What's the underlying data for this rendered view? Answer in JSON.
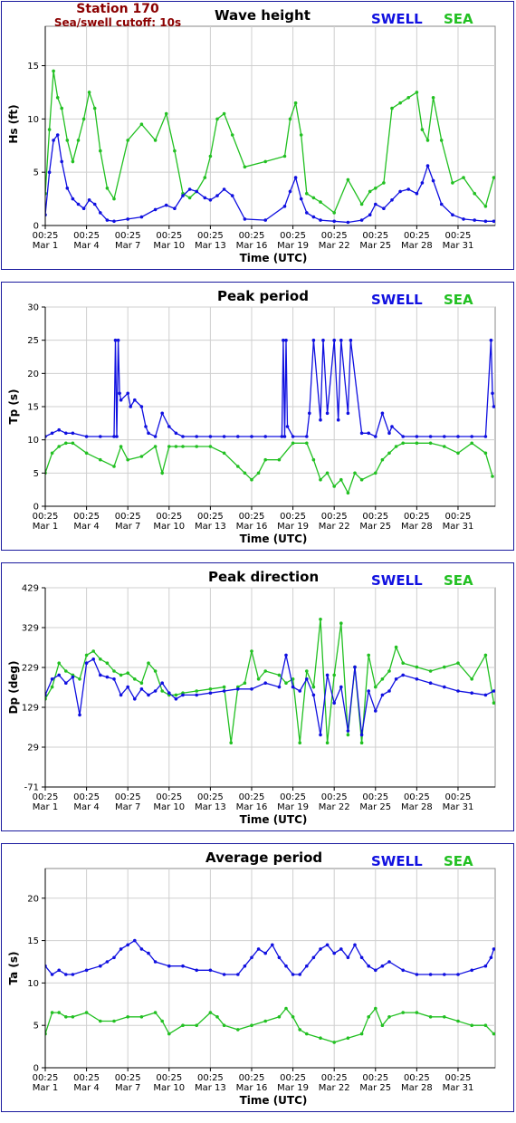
{
  "header": {
    "station": "Station 170",
    "cutoff": "Sea/swell cutoff: 10s"
  },
  "legend": {
    "swell": "SWELL",
    "sea": "SEA"
  },
  "colors": {
    "swell": "#1010e0",
    "sea": "#22c022",
    "frame": "#1a1a9e",
    "header": "#8b0000"
  },
  "x_ticks": {
    "times": [
      "00:25",
      "00:25",
      "00:25",
      "00:25",
      "00:25",
      "00:25",
      "00:25",
      "00:25",
      "00:25",
      "00:25",
      "00:25"
    ],
    "dates": [
      "Mar 1",
      "Mar 4",
      "Mar 7",
      "Mar 10",
      "Mar 13",
      "Mar 16",
      "Mar 19",
      "Mar 22",
      "Mar 25",
      "Mar 28",
      "Mar 31"
    ],
    "days": [
      1,
      4,
      7,
      10,
      13,
      16,
      19,
      22,
      25,
      28,
      31
    ]
  },
  "chart_data": [
    {
      "type": "line",
      "title": "Wave height",
      "ylabel": "Hs (ft)",
      "xlabel": "Time (UTC)",
      "xlim": [
        1,
        33.7
      ],
      "ylim": [
        0,
        18.7
      ],
      "yticks": [
        0,
        5,
        10,
        15
      ],
      "grid": true,
      "legend": "top-right",
      "series": [
        {
          "name": "SWELL",
          "color": "#1010e0",
          "x": [
            1,
            1.3,
            1.6,
            1.9,
            2.2,
            2.6,
            3,
            3.4,
            3.8,
            4.2,
            4.6,
            5,
            5.5,
            6,
            7,
            8,
            9,
            9.8,
            10.4,
            11,
            11.5,
            12,
            12.6,
            13,
            13.5,
            14,
            14.6,
            15.5,
            17,
            18.4,
            18.8,
            19.2,
            19.6,
            20,
            20.5,
            21,
            22,
            23,
            24,
            24.6,
            25,
            25.6,
            26.2,
            26.8,
            27.4,
            28,
            28.4,
            28.8,
            29.2,
            29.8,
            30.6,
            31.4,
            32.2,
            33,
            33.6
          ],
          "y": [
            1,
            5,
            8,
            8.5,
            6,
            3.5,
            2.5,
            2,
            1.6,
            2.4,
            2,
            1.2,
            0.5,
            0.4,
            0.6,
            0.8,
            1.5,
            1.9,
            1.6,
            2.8,
            3.4,
            3.2,
            2.6,
            2.4,
            2.8,
            3.4,
            2.8,
            0.6,
            0.5,
            1.8,
            3.2,
            4.5,
            2.5,
            1.2,
            0.8,
            0.5,
            0.4,
            0.3,
            0.5,
            1,
            2,
            1.6,
            2.4,
            3.2,
            3.4,
            3,
            4,
            5.6,
            4.2,
            2,
            1,
            0.6,
            0.5,
            0.4,
            0.4
          ]
        },
        {
          "name": "SEA",
          "color": "#22c022",
          "x": [
            1,
            1.3,
            1.6,
            1.9,
            2.2,
            2.6,
            3,
            3.4,
            3.8,
            4.2,
            4.6,
            5,
            5.5,
            6,
            7,
            8,
            9,
            9.8,
            10.4,
            11,
            11.5,
            12,
            12.6,
            13,
            13.5,
            14,
            14.6,
            15.5,
            17,
            18.4,
            18.8,
            19.2,
            19.6,
            20,
            20.5,
            21,
            22,
            23,
            24,
            24.6,
            25,
            25.6,
            26.2,
            26.8,
            27.4,
            28,
            28.4,
            28.8,
            29.2,
            29.8,
            30.6,
            31.4,
            32.2,
            33,
            33.6
          ],
          "y": [
            3,
            9,
            14.5,
            12,
            11,
            8,
            6,
            8,
            10,
            12.5,
            11,
            7,
            3.5,
            2.5,
            8,
            9.5,
            8,
            10.5,
            7,
            3,
            2.6,
            3.2,
            4.5,
            6.5,
            10,
            10.5,
            8.5,
            5.5,
            6,
            6.5,
            10,
            11.5,
            8.5,
            3,
            2.6,
            2.2,
            1.2,
            4.3,
            2,
            3.2,
            3.5,
            4,
            11,
            11.5,
            12,
            12.5,
            9,
            8,
            12,
            8,
            4,
            4.5,
            3,
            1.8,
            4.5
          ]
        }
      ]
    },
    {
      "type": "line",
      "title": "Peak period",
      "ylabel": "Tp (s)",
      "xlabel": "Time (UTC)",
      "xlim": [
        1,
        33.7
      ],
      "ylim": [
        0,
        30
      ],
      "yticks": [
        0,
        5,
        10,
        15,
        20,
        25,
        30
      ],
      "grid": true,
      "legend": "top-right",
      "series": [
        {
          "name": "SWELL",
          "color": "#1010e0",
          "x": [
            1,
            1.5,
            2,
            2.5,
            3,
            4,
            5,
            6,
            6.1,
            6.2,
            6.3,
            6.4,
            6.5,
            7,
            7.2,
            7.5,
            8,
            8.3,
            8.5,
            9,
            9.5,
            10,
            10.5,
            11,
            12,
            13,
            14,
            15,
            16,
            17,
            18.2,
            18.3,
            18.4,
            18.5,
            18.6,
            19,
            20,
            20.2,
            20.5,
            21,
            21.2,
            21.5,
            22,
            22.3,
            22.5,
            23,
            23.2,
            24,
            24.5,
            25,
            25.5,
            26,
            26.2,
            27,
            28,
            29,
            30,
            31,
            32,
            33,
            33.4,
            33.5,
            33.6
          ],
          "y": [
            10.5,
            11,
            11.5,
            11,
            11,
            10.5,
            10.5,
            10.5,
            25,
            10.5,
            25,
            17,
            16,
            17,
            15,
            16,
            15,
            12,
            11,
            10.5,
            14,
            12,
            11,
            10.5,
            10.5,
            10.5,
            10.5,
            10.5,
            10.5,
            10.5,
            10.5,
            25,
            10.5,
            25,
            12,
            10.5,
            10.5,
            14,
            25,
            13,
            25,
            14,
            25,
            13,
            25,
            14,
            25,
            11,
            11,
            10.5,
            14,
            11,
            12,
            10.5,
            10.5,
            10.5,
            10.5,
            10.5,
            10.5,
            10.5,
            25,
            17,
            15
          ]
        },
        {
          "name": "SEA",
          "color": "#22c022",
          "x": [
            1,
            1.5,
            2,
            2.5,
            3,
            4,
            5,
            6,
            6.5,
            7,
            8,
            9,
            9.5,
            10,
            10.5,
            11,
            12,
            13,
            14,
            15,
            15.5,
            16,
            16.5,
            17,
            18,
            19,
            20,
            20.5,
            21,
            21.5,
            22,
            22.5,
            23,
            23.5,
            24,
            25,
            25.5,
            26,
            26.5,
            27,
            28,
            29,
            30,
            31,
            32,
            33,
            33.5
          ],
          "y": [
            5,
            8,
            9,
            9.5,
            9.5,
            8,
            7,
            6,
            9,
            7,
            7.5,
            9,
            5,
            9,
            9,
            9,
            9,
            9,
            8,
            6,
            5,
            4,
            5,
            7,
            7,
            9.5,
            9.5,
            7,
            4,
            5,
            3,
            4,
            2,
            5,
            4,
            5,
            7,
            8,
            9,
            9.5,
            9.5,
            9.5,
            9,
            8,
            9.5,
            8,
            4.5
          ]
        }
      ]
    },
    {
      "type": "line",
      "title": "Peak direction",
      "ylabel": "Dp (deg)",
      "xlabel": "Time (UTC)",
      "xlim": [
        1,
        33.7
      ],
      "ylim": [
        -71,
        429
      ],
      "yticks": [
        -71,
        29,
        129,
        229,
        329,
        429
      ],
      "grid": true,
      "legend": "top-right",
      "series": [
        {
          "name": "SWELL",
          "color": "#1010e0",
          "x": [
            1,
            1.5,
            2,
            2.5,
            3,
            3.5,
            4,
            4.5,
            5,
            5.5,
            6,
            6.5,
            7,
            7.5,
            8,
            8.5,
            9,
            9.5,
            10,
            10.5,
            11,
            12,
            13,
            14,
            15,
            16,
            17,
            18,
            18.5,
            19,
            19.5,
            20,
            20.5,
            21,
            21.5,
            22,
            22.5,
            23,
            23.5,
            24,
            24.5,
            25,
            25.5,
            26,
            26.5,
            27,
            28,
            29,
            30,
            31,
            32,
            33,
            33.6
          ],
          "y": [
            160,
            200,
            210,
            190,
            205,
            110,
            240,
            250,
            210,
            205,
            200,
            160,
            180,
            150,
            175,
            160,
            170,
            190,
            165,
            150,
            160,
            160,
            165,
            170,
            175,
            175,
            190,
            180,
            260,
            180,
            170,
            200,
            160,
            60,
            210,
            140,
            180,
            70,
            230,
            60,
            170,
            120,
            160,
            170,
            200,
            210,
            200,
            190,
            180,
            170,
            165,
            160,
            170
          ]
        },
        {
          "name": "SEA",
          "color": "#22c022",
          "x": [
            1,
            1.5,
            2,
            2.5,
            3,
            3.5,
            4,
            4.5,
            5,
            5.5,
            6,
            6.5,
            7,
            7.5,
            8,
            8.5,
            9,
            9.5,
            10,
            10.5,
            11,
            12,
            13,
            14,
            14.5,
            15,
            15.5,
            16,
            16.5,
            17,
            18,
            18.5,
            19,
            19.5,
            20,
            20.5,
            21,
            21.5,
            22,
            22.5,
            23,
            23.5,
            24,
            24.5,
            25,
            25.5,
            26,
            26.5,
            27,
            28,
            29,
            30,
            31,
            32,
            33,
            33.6
          ],
          "y": [
            150,
            180,
            240,
            220,
            210,
            200,
            260,
            270,
            250,
            240,
            220,
            210,
            215,
            200,
            190,
            240,
            220,
            170,
            160,
            160,
            165,
            170,
            175,
            180,
            40,
            180,
            190,
            270,
            200,
            220,
            210,
            190,
            200,
            40,
            220,
            180,
            350,
            40,
            210,
            340,
            60,
            230,
            40,
            260,
            180,
            200,
            220,
            280,
            240,
            230,
            220,
            230,
            240,
            200,
            260,
            140
          ]
        }
      ]
    },
    {
      "type": "line",
      "title": "Average period",
      "ylabel": "Ta (s)",
      "xlabel": "Time (UTC)",
      "xlim": [
        1,
        33.7
      ],
      "ylim": [
        0,
        23.5
      ],
      "yticks": [
        0,
        5,
        10,
        15,
        20
      ],
      "grid": true,
      "legend": "top-right",
      "series": [
        {
          "name": "SWELL",
          "color": "#1010e0",
          "x": [
            1,
            1.5,
            2,
            2.5,
            3,
            4,
            5,
            5.5,
            6,
            6.5,
            7,
            7.5,
            8,
            8.5,
            9,
            10,
            11,
            12,
            13,
            14,
            15,
            15.5,
            16,
            16.5,
            17,
            17.5,
            18,
            18.5,
            19,
            19.5,
            20,
            20.5,
            21,
            21.5,
            22,
            22.5,
            23,
            23.5,
            24,
            24.5,
            25,
            25.5,
            26,
            27,
            28,
            29,
            30,
            31,
            32,
            33,
            33.4,
            33.6
          ],
          "y": [
            12,
            11,
            11.5,
            11,
            11,
            11.5,
            12,
            12.5,
            13,
            14,
            14.5,
            15,
            14,
            13.5,
            12.5,
            12,
            12,
            11.5,
            11.5,
            11,
            11,
            12,
            13,
            14,
            13.5,
            14.5,
            13,
            12,
            11,
            11,
            12,
            13,
            14,
            14.5,
            13.5,
            14,
            13,
            14.5,
            13,
            12,
            11.5,
            12,
            12.5,
            11.5,
            11,
            11,
            11,
            11,
            11.5,
            12,
            13,
            14
          ]
        },
        {
          "name": "SEA",
          "color": "#22c022",
          "x": [
            1,
            1.5,
            2,
            2.5,
            3,
            4,
            5,
            6,
            7,
            8,
            9,
            9.5,
            10,
            11,
            12,
            13,
            13.5,
            14,
            15,
            16,
            17,
            18,
            18.5,
            19,
            19.5,
            20,
            21,
            22,
            23,
            24,
            24.5,
            25,
            25.5,
            26,
            27,
            28,
            29,
            30,
            31,
            32,
            33,
            33.6
          ],
          "y": [
            4,
            6.5,
            6.5,
            6,
            6,
            6.5,
            5.5,
            5.5,
            6,
            6,
            6.5,
            5.5,
            4,
            5,
            5,
            6.5,
            6,
            5,
            4.5,
            5,
            5.5,
            6,
            7,
            6,
            4.5,
            4,
            3.5,
            3,
            3.5,
            4,
            6,
            7,
            5,
            6,
            6.5,
            6.5,
            6,
            6,
            5.5,
            5,
            5,
            4
          ]
        }
      ]
    }
  ]
}
